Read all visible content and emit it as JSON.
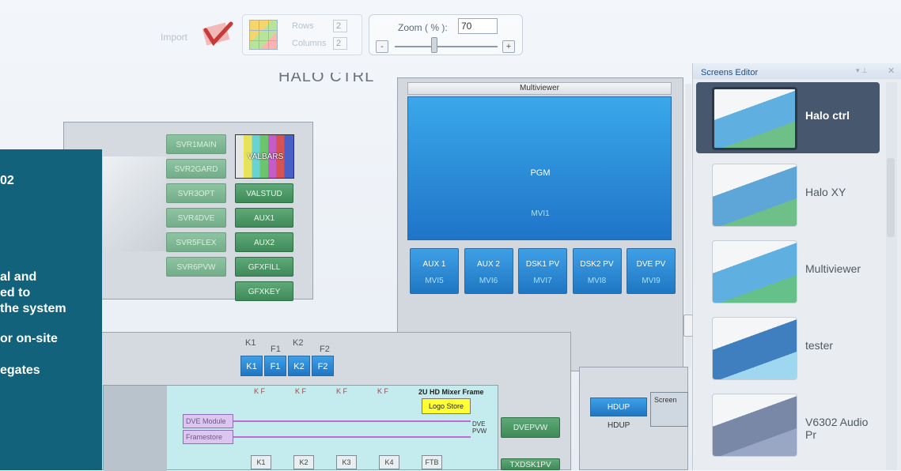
{
  "toolbar": {
    "import_label": "Import",
    "rows_label": "Rows",
    "rows_value": "2",
    "columns_label": "Columns",
    "columns_value": "2",
    "zoom_label": "Zoom ( % ):",
    "zoom_value": "70",
    "zoom_minus": "-",
    "zoom_plus": "+",
    "zoom_slider_percent": 70
  },
  "canvas": {
    "title": "HALO CTRL",
    "source_buttons_left": [
      "SVR1MAIN",
      "SVR2GARD",
      "SVR3OPT",
      "SVR4DVE",
      "SVR5FLEX",
      "SVR6PVW"
    ],
    "source_buttons_right": [
      "VALSTUD",
      "AUX1",
      "AUX2",
      "GFXFILL",
      "GFXKEY"
    ],
    "valbars_label": "VALBARS",
    "multiviewer": {
      "header": "Multiviewer",
      "pgm_label": "PGM",
      "pgm_sub": "MVI1",
      "buttons": [
        {
          "label": "AUX 1",
          "sub": "MVI5"
        },
        {
          "label": "AUX 2",
          "sub": "MVI6"
        },
        {
          "label": "DSK1 PV",
          "sub": "MVI7"
        },
        {
          "label": "DSK2 PV",
          "sub": "MVI8"
        },
        {
          "label": "DVE PV",
          "sub": "MVI9"
        }
      ]
    },
    "keyer": {
      "labels_top": [
        "K1",
        "F1",
        "K2",
        "F2"
      ],
      "buttons": [
        "K1",
        "F1",
        "K2",
        "F2"
      ]
    },
    "mixer": {
      "frame_label": "2U HD Mixer Frame",
      "logo_store": "Logo Store",
      "dve_module": "DVE Module",
      "framestore": "Framestore",
      "dve_pvw": "DVE\nPVW",
      "kf_labels": [
        "K F",
        "K F",
        "K F",
        "K F"
      ],
      "key_cells": [
        "K1",
        "K2",
        "K3",
        "K4",
        "FTB"
      ]
    },
    "dvepvw_button": "DVEPVW",
    "txdsk_button": "TXDSK1PV",
    "hdup_button": "HDUP",
    "hdup_label": "HDUP",
    "screen_label": "Screen"
  },
  "screens_editor": {
    "title": "Screens Editor",
    "items": [
      {
        "label": "Halo ctrl",
        "selected": true
      },
      {
        "label": "Halo XY",
        "selected": false
      },
      {
        "label": "Multiviewer",
        "selected": false
      },
      {
        "label": "tester",
        "selected": false
      },
      {
        "label": "V6302 Audio Pr",
        "selected": false
      }
    ]
  },
  "overlay": {
    "lines": [
      "02",
      "al and",
      "ed to",
      "the system",
      "or on-site",
      "egates"
    ]
  },
  "colors": {
    "overlay_bg": "#12627c",
    "green_button": "#3f8a59",
    "blue_button": "#1f76c2",
    "selected_item": "#46576e"
  }
}
